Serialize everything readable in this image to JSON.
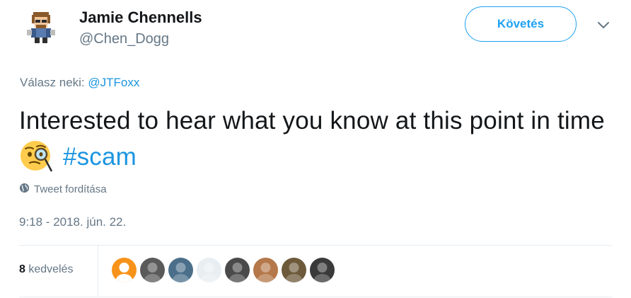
{
  "user": {
    "display_name": "Jamie Chennells",
    "handle": "@Chen_Dogg"
  },
  "follow_button": {
    "label": "Követés"
  },
  "reply": {
    "prefix": "Válasz neki:",
    "mention": "@JTFoxx"
  },
  "tweet": {
    "text_before_emoji": "Interested to hear what you know at this point in time",
    "emoji": "face-with-monocle-icon",
    "hashtag": "#scam"
  },
  "translate": {
    "label": "Tweet fordítása",
    "icon": "globe-icon"
  },
  "timestamp": "9:18 - 2018. jún. 22.",
  "likes": {
    "count": "8",
    "label": "kedvelés",
    "likers": [
      {
        "name": "liker-avatar-1",
        "bg": "#f7931a"
      },
      {
        "name": "liker-avatar-2",
        "bg": "#5a5a5a"
      },
      {
        "name": "liker-avatar-3",
        "bg": "#4b6f8a"
      },
      {
        "name": "liker-avatar-4",
        "bg": "#e8eef2"
      },
      {
        "name": "liker-avatar-5",
        "bg": "#4a4a4a"
      },
      {
        "name": "liker-avatar-6",
        "bg": "#b5784a"
      },
      {
        "name": "liker-avatar-7",
        "bg": "#6d5a3a"
      },
      {
        "name": "liker-avatar-8",
        "bg": "#3a3a3a"
      }
    ]
  },
  "colors": {
    "accent": "#1da1f2",
    "link": "#1b95e0",
    "muted": "#657786",
    "text": "#14171a"
  }
}
